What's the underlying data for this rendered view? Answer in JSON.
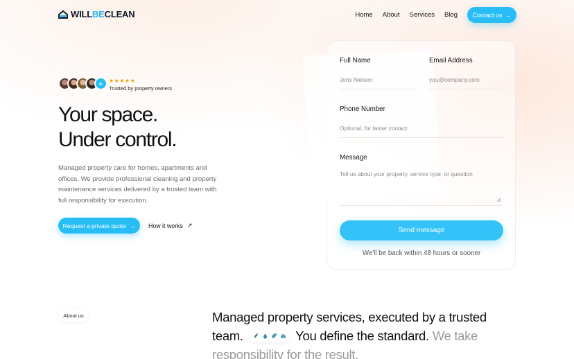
{
  "brand": {
    "logo_prefix": "WILL",
    "logo_accent": "BE",
    "logo_suffix": "CLEAN",
    "accent_color": "#29bdf6"
  },
  "nav": {
    "items": [
      "Home",
      "About",
      "Services",
      "Blog"
    ],
    "contact_label": "Contact us"
  },
  "hero": {
    "stars": "★★★★★",
    "trusted_text": "Trusted by property owners",
    "title_line1": "Your space.",
    "title_line2": "Under control.",
    "description": "Managed property care for homes, apartments and offices.  We provide professional cleaning and property maintenance services delivered by a trusted team with full responsibility for execution.",
    "cta_label": "Request a private quote",
    "secondary_label": "How it works"
  },
  "form": {
    "full_name_label": "Full Name",
    "full_name_placeholder": "Jens Nielsen",
    "email_label": "Email Address",
    "email_placeholder": "you@company.com",
    "phone_label": "Phone Number",
    "phone_placeholder": "Optional, for faster contact",
    "message_label": "Message",
    "message_placeholder": "Tell us about your property, service type, or question",
    "submit_label": "Send message",
    "response_note": "We'll be back within 48 hours or sooner"
  },
  "about": {
    "pill_label": "About us",
    "text_part1": "Managed property services, executed by a trusted team.",
    "text_part2": "You define the standard.",
    "text_part3": "We take responsibility for the result."
  }
}
